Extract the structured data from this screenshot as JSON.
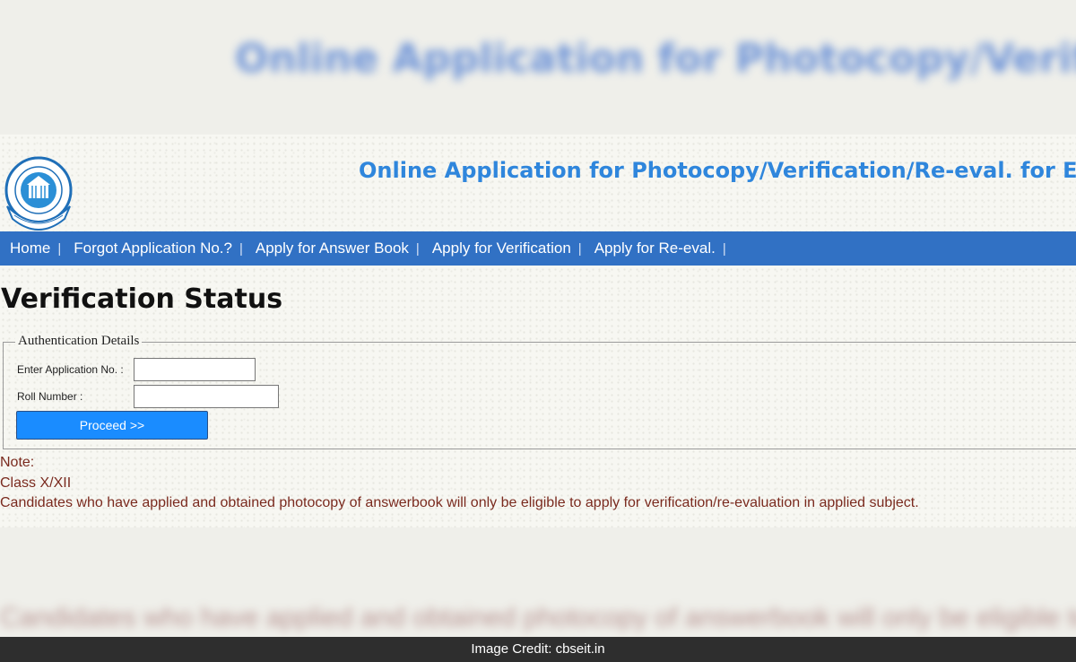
{
  "header": {
    "title": "Online Application for Photocopy/Verification/Re-eval. for Exam"
  },
  "nav": {
    "items": [
      {
        "label": "Home"
      },
      {
        "label": "Forgot Application No.?"
      },
      {
        "label": "Apply for Answer Book"
      },
      {
        "label": "Apply for Verification"
      },
      {
        "label": "Apply for Re-eval."
      }
    ],
    "separator": "|"
  },
  "main": {
    "page_title": "Verification Status",
    "auth": {
      "legend": "Authentication Details",
      "application_no_label": "Enter Application No. :",
      "application_no_value": "",
      "roll_number_label": "Roll Number :",
      "roll_number_value": "",
      "proceed_label": "Proceed >>"
    },
    "note": {
      "heading": "Note:",
      "class_line": "Class X/XII",
      "text": "Candidates who have applied and obtained photocopy of answerbook will only be eligible to apply for verification/re-evaluation in applied subject."
    }
  },
  "credit": {
    "text": "Image Credit: cbseit.in"
  },
  "colors": {
    "nav_bg": "#3171c4",
    "title_blue": "#2f86dc",
    "button_blue": "#1a8cff",
    "note_text": "#7a2a1e",
    "credit_bg": "#2e2e2e"
  },
  "icons": {
    "logo": "cbse-emblem-logo"
  }
}
